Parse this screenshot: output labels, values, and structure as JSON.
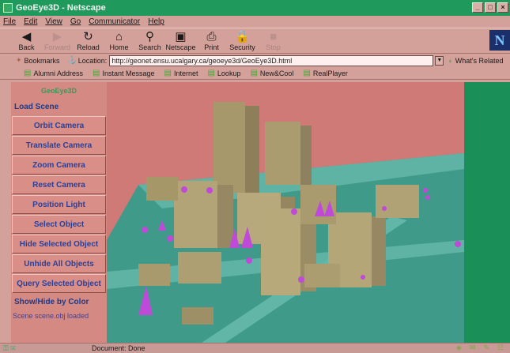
{
  "window": {
    "title": "GeoEye3D - Netscape",
    "controls": [
      "_",
      "□",
      "×"
    ]
  },
  "menu": [
    "File",
    "Edit",
    "View",
    "Go",
    "Communicator",
    "Help"
  ],
  "toolbar": [
    {
      "label": "Back",
      "icon": "back-arrow-icon",
      "glyph": "◀",
      "enabled": true
    },
    {
      "label": "Forward",
      "icon": "forward-arrow-icon",
      "glyph": "▶",
      "enabled": false
    },
    {
      "label": "Reload",
      "icon": "reload-icon",
      "glyph": "↻",
      "enabled": true
    },
    {
      "label": "Home",
      "icon": "home-icon",
      "glyph": "⌂",
      "enabled": true
    },
    {
      "label": "Search",
      "icon": "search-icon",
      "glyph": "⚲",
      "enabled": true
    },
    {
      "label": "Netscape",
      "icon": "netscape-icon",
      "glyph": "▣",
      "enabled": true
    },
    {
      "label": "Print",
      "icon": "print-icon",
      "glyph": "⎙",
      "enabled": true
    },
    {
      "label": "Security",
      "icon": "security-lock-icon",
      "glyph": "🔒",
      "enabled": true
    },
    {
      "label": "Stop",
      "icon": "stop-icon",
      "glyph": "■",
      "enabled": false
    }
  ],
  "location": {
    "bookmarks_label": "Bookmarks",
    "location_label": "Location:",
    "url": "http://geonet.ensu.ucalgary.ca/geoeye3d/GeoEye3D.html",
    "related_label": "What's Related"
  },
  "personal_toolbar": [
    "Alumni Address",
    "Instant Message",
    "Internet",
    "Lookup",
    "New&Cool",
    "RealPlayer"
  ],
  "panel": {
    "title": "GeoEye3D",
    "load_scene": "Load Scene",
    "buttons": [
      "Orbit Camera",
      "Translate Camera",
      "Zoom Camera",
      "Reset Camera",
      "Position Light",
      "Select Object",
      "Hide Selected Object",
      "Unhide All Objects",
      "Query Selected Object"
    ],
    "show_hide": "Show/Hide by Color",
    "status_message": "Scene scene.obj loaded"
  },
  "status_bar": {
    "text": "Document: Done"
  },
  "colors": {
    "titlebar": "#1f9a5c",
    "viewport_bg": "#d07a78",
    "ground": "#3f9a8a",
    "building": "#b8a878",
    "marker": "#c04ad8",
    "right_panel": "#1a8f57"
  }
}
